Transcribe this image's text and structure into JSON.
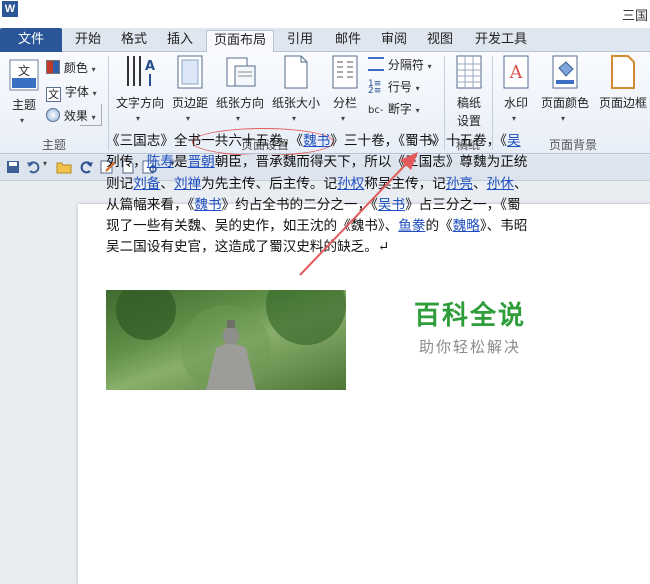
{
  "window": {
    "title": "三国"
  },
  "tabs": [
    {
      "label": "文件"
    },
    {
      "label": "开始"
    },
    {
      "label": "格式"
    },
    {
      "label": "插入"
    },
    {
      "label": "页面布局"
    },
    {
      "label": "引用"
    },
    {
      "label": "邮件"
    },
    {
      "label": "审阅"
    },
    {
      "label": "视图"
    },
    {
      "label": "开发工具"
    }
  ],
  "ribbon": {
    "theme_group": {
      "label": "主题",
      "theme_button": "主题",
      "colors": "颜色",
      "fonts": "字体",
      "effects": "效果"
    },
    "page_setup_group": {
      "label": "页面设置",
      "text_direction": "文字方向",
      "margins": "页边距",
      "orientation": "纸张方向",
      "size": "纸张大小",
      "columns": "分栏",
      "breaks": "分隔符",
      "line_numbers": "行号",
      "hyphenation": "断字"
    },
    "manuscript_group": {
      "label": "稿纸",
      "button_line1": "稿纸",
      "button_line2": "设置"
    },
    "page_background_group": {
      "label": "页面背景",
      "watermark": "水印",
      "page_color": "页面颜色",
      "page_borders": "页面边框"
    }
  },
  "document": {
    "paragraph_lines": [
      [
        {
          "t": "《三国志》全书一共六十五卷，《"
        },
        {
          "t": "魏书",
          "link": true
        },
        {
          "t": "》三十卷，《蜀书》十五卷，《"
        },
        {
          "t": "吴",
          "link": true
        }
      ],
      [
        {
          "t": "列传，"
        },
        {
          "t": "陈寿",
          "link": true
        },
        {
          "t": "是"
        },
        {
          "t": "晋朝",
          "link": true
        },
        {
          "t": "朝臣，晋承魏而得天下，所以《三国志》尊魏为正统"
        }
      ],
      [
        {
          "t": "则记"
        },
        {
          "t": "刘备",
          "link": true
        },
        {
          "t": "、"
        },
        {
          "t": "刘禅",
          "link": true
        },
        {
          "t": "为先主传、后主传。记"
        },
        {
          "t": "孙权",
          "link": true
        },
        {
          "t": "称吴主传，记"
        },
        {
          "t": "孙亮",
          "link": true
        },
        {
          "t": "、"
        },
        {
          "t": "孙休",
          "link": true
        },
        {
          "t": "、"
        }
      ],
      [
        {
          "t": "从篇幅来看，《"
        },
        {
          "t": "魏书",
          "link": true
        },
        {
          "t": "》约占全书的二分之一，《"
        },
        {
          "t": "吴书",
          "link": true
        },
        {
          "t": "》占三分之一，《蜀"
        }
      ],
      [
        {
          "t": "现了一些有关魏、吴的史作，如王沈的《魏书》、"
        },
        {
          "t": "鱼豢",
          "link": true
        },
        {
          "t": "的《"
        },
        {
          "t": "魏略",
          "link": true
        },
        {
          "t": "》、韦昭"
        }
      ],
      [
        {
          "t": "吴二国设有史官，这造成了蜀汉史料的缺乏。↵"
        }
      ]
    ]
  },
  "watermark_text": {
    "title": "百科全说",
    "subtitle": "助你轻松解决"
  },
  "colors": {
    "file_tab": "#2a5699",
    "annotation_red": "#e35a5a",
    "link": "#1f4fbf",
    "watermark_green": "#2e9d3a"
  }
}
